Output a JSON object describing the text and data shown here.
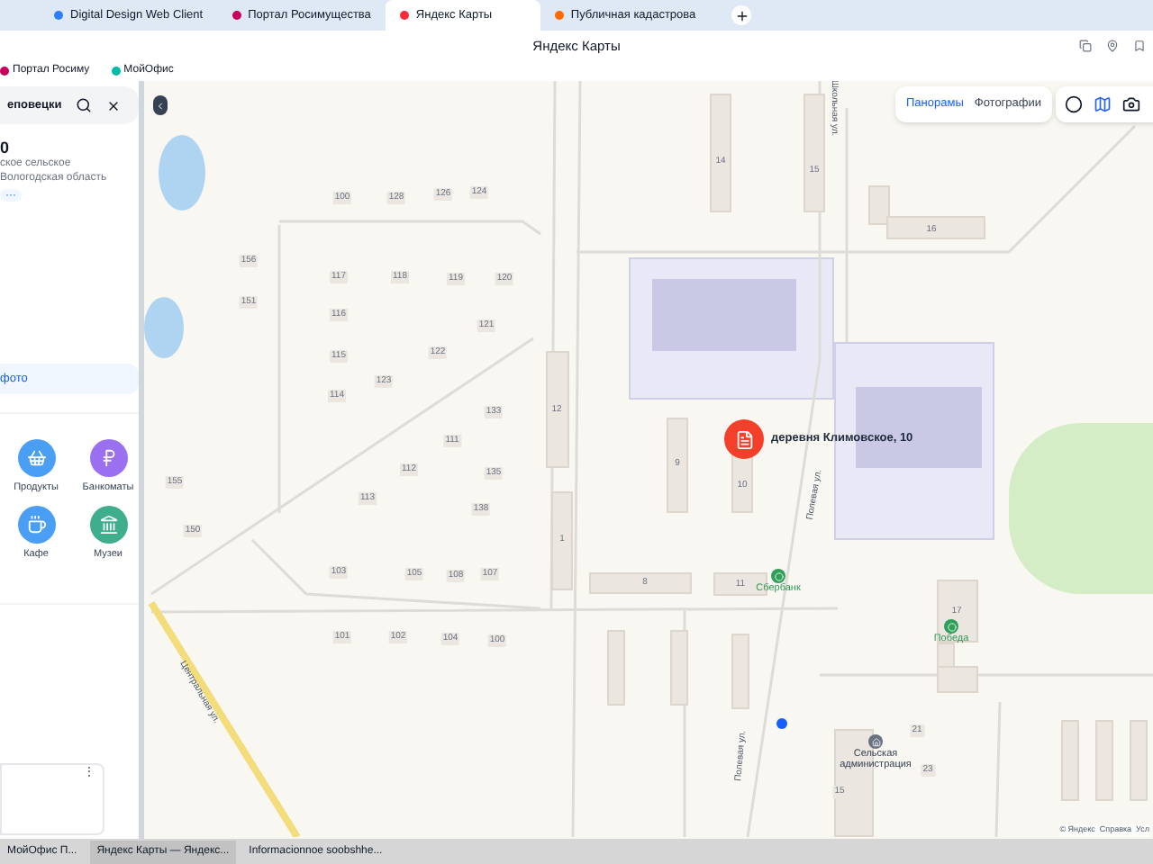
{
  "browser": {
    "tabs": [
      {
        "title": "Digital Design Web Client",
        "selected": false
      },
      {
        "title": "Портал Росимущества",
        "selected": false
      },
      {
        "title": "Яндекс Карты",
        "selected": true
      },
      {
        "title": "Публичная кадастрова",
        "selected": false
      }
    ],
    "page_title": "Яндекс Карты",
    "bookmarks": [
      "Портал Росиму",
      "МойОфис"
    ]
  },
  "panel": {
    "search_value": "еповецки",
    "heading": "0",
    "address_lines": [
      "ское сельское",
      "Вологодская область"
    ],
    "more": "···",
    "photo_button": "фото",
    "categories": [
      {
        "label": "Продукты",
        "kind": "basket",
        "color": "#4a9ff5"
      },
      {
        "label": "Банкоматы",
        "kind": "ruble",
        "color": "#9a6ff0"
      },
      {
        "label": "Кафе",
        "kind": "cup",
        "color": "#4a9ff5"
      },
      {
        "label": "Музеи",
        "kind": "museum",
        "color": "#3fae8c"
      }
    ],
    "card_menu": "⋮"
  },
  "map": {
    "mode_tabs": [
      {
        "label": "Панорамы",
        "selected": true
      },
      {
        "label": "Фотографии",
        "selected": false
      }
    ],
    "marker_label": "деревня Климовское, 10",
    "pois": [
      {
        "label": "Сбербанк",
        "kind": "bank"
      },
      {
        "label": "Победа",
        "kind": "shop"
      },
      {
        "label": "Сельская администрация",
        "kind": "office"
      }
    ],
    "streets": [
      "Школьная ул.",
      "Полевая ул.",
      "Полевая ул.",
      "Центральная ул."
    ],
    "house_numbers": [
      "100",
      "128",
      "126",
      "124",
      "156",
      "151",
      "117",
      "118",
      "119",
      "120",
      "116",
      "121",
      "115",
      "122",
      "123",
      "114",
      "133",
      "111",
      "112",
      "135",
      "113",
      "138",
      "155",
      "150",
      "103",
      "105",
      "108",
      "107",
      "101",
      "102",
      "104",
      "100",
      "12",
      "1",
      "9",
      "10",
      "8",
      "11",
      "16",
      "17",
      "21",
      "23",
      "15",
      "14",
      "15"
    ],
    "attribution": "© Яндекс  Справка  Усл"
  },
  "taskbar": [
    "МойОфис П...",
    "Яндекс Карты — Яндекс...",
    "Informacionnoe soobshhe..."
  ]
}
